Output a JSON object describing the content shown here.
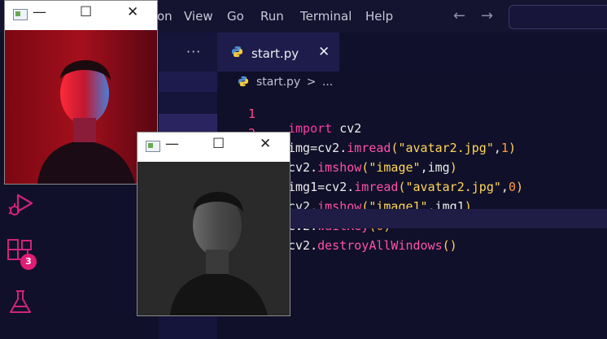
{
  "menubar": {
    "items": [
      "on",
      "View",
      "Go",
      "Run",
      "Terminal",
      "Help"
    ],
    "back_arrow": "←",
    "forward_arrow": "→"
  },
  "sidebar": {
    "more_actions": "···"
  },
  "tab": {
    "label": "start.py",
    "close": "✕"
  },
  "breadcrumb": {
    "file": "start.py",
    "separator": ">",
    "more": "..."
  },
  "code": {
    "lines": [
      {
        "num": "1",
        "text": "import cv2"
      },
      {
        "num": "2",
        "text": "img=cv2.imread(\"avatar2.jpg\",1)"
      },
      {
        "num": "",
        "text": "cv2.imshow(\"image\",img)"
      },
      {
        "num": "",
        "text": "img1=cv2.imread(\"avatar2.jpg\",0)"
      },
      {
        "num": "",
        "text": "cv2.imshow(\"image1\",img1)"
      },
      {
        "num": "",
        "text": "cv2.waitKey(0)"
      },
      {
        "num": "",
        "text": "cv2.destroyAllWindows()"
      }
    ]
  },
  "activity_bar": {
    "extensions_badge": "3",
    "icons": [
      "run-debug-icon",
      "extensions-icon",
      "flask-icon"
    ]
  },
  "windows": {
    "color_window": {
      "minimize": "—",
      "maximize": "☐",
      "close": "✕"
    },
    "gray_window": {
      "minimize": "—",
      "maximize": "☐",
      "close": "✕"
    }
  },
  "colors": {
    "background": "#10102a",
    "keyword": "#ff3aa0",
    "string": "#ffd659",
    "number": "#ff9a3c",
    "line_number": "#ff4b8d",
    "badge": "#e01c74"
  }
}
